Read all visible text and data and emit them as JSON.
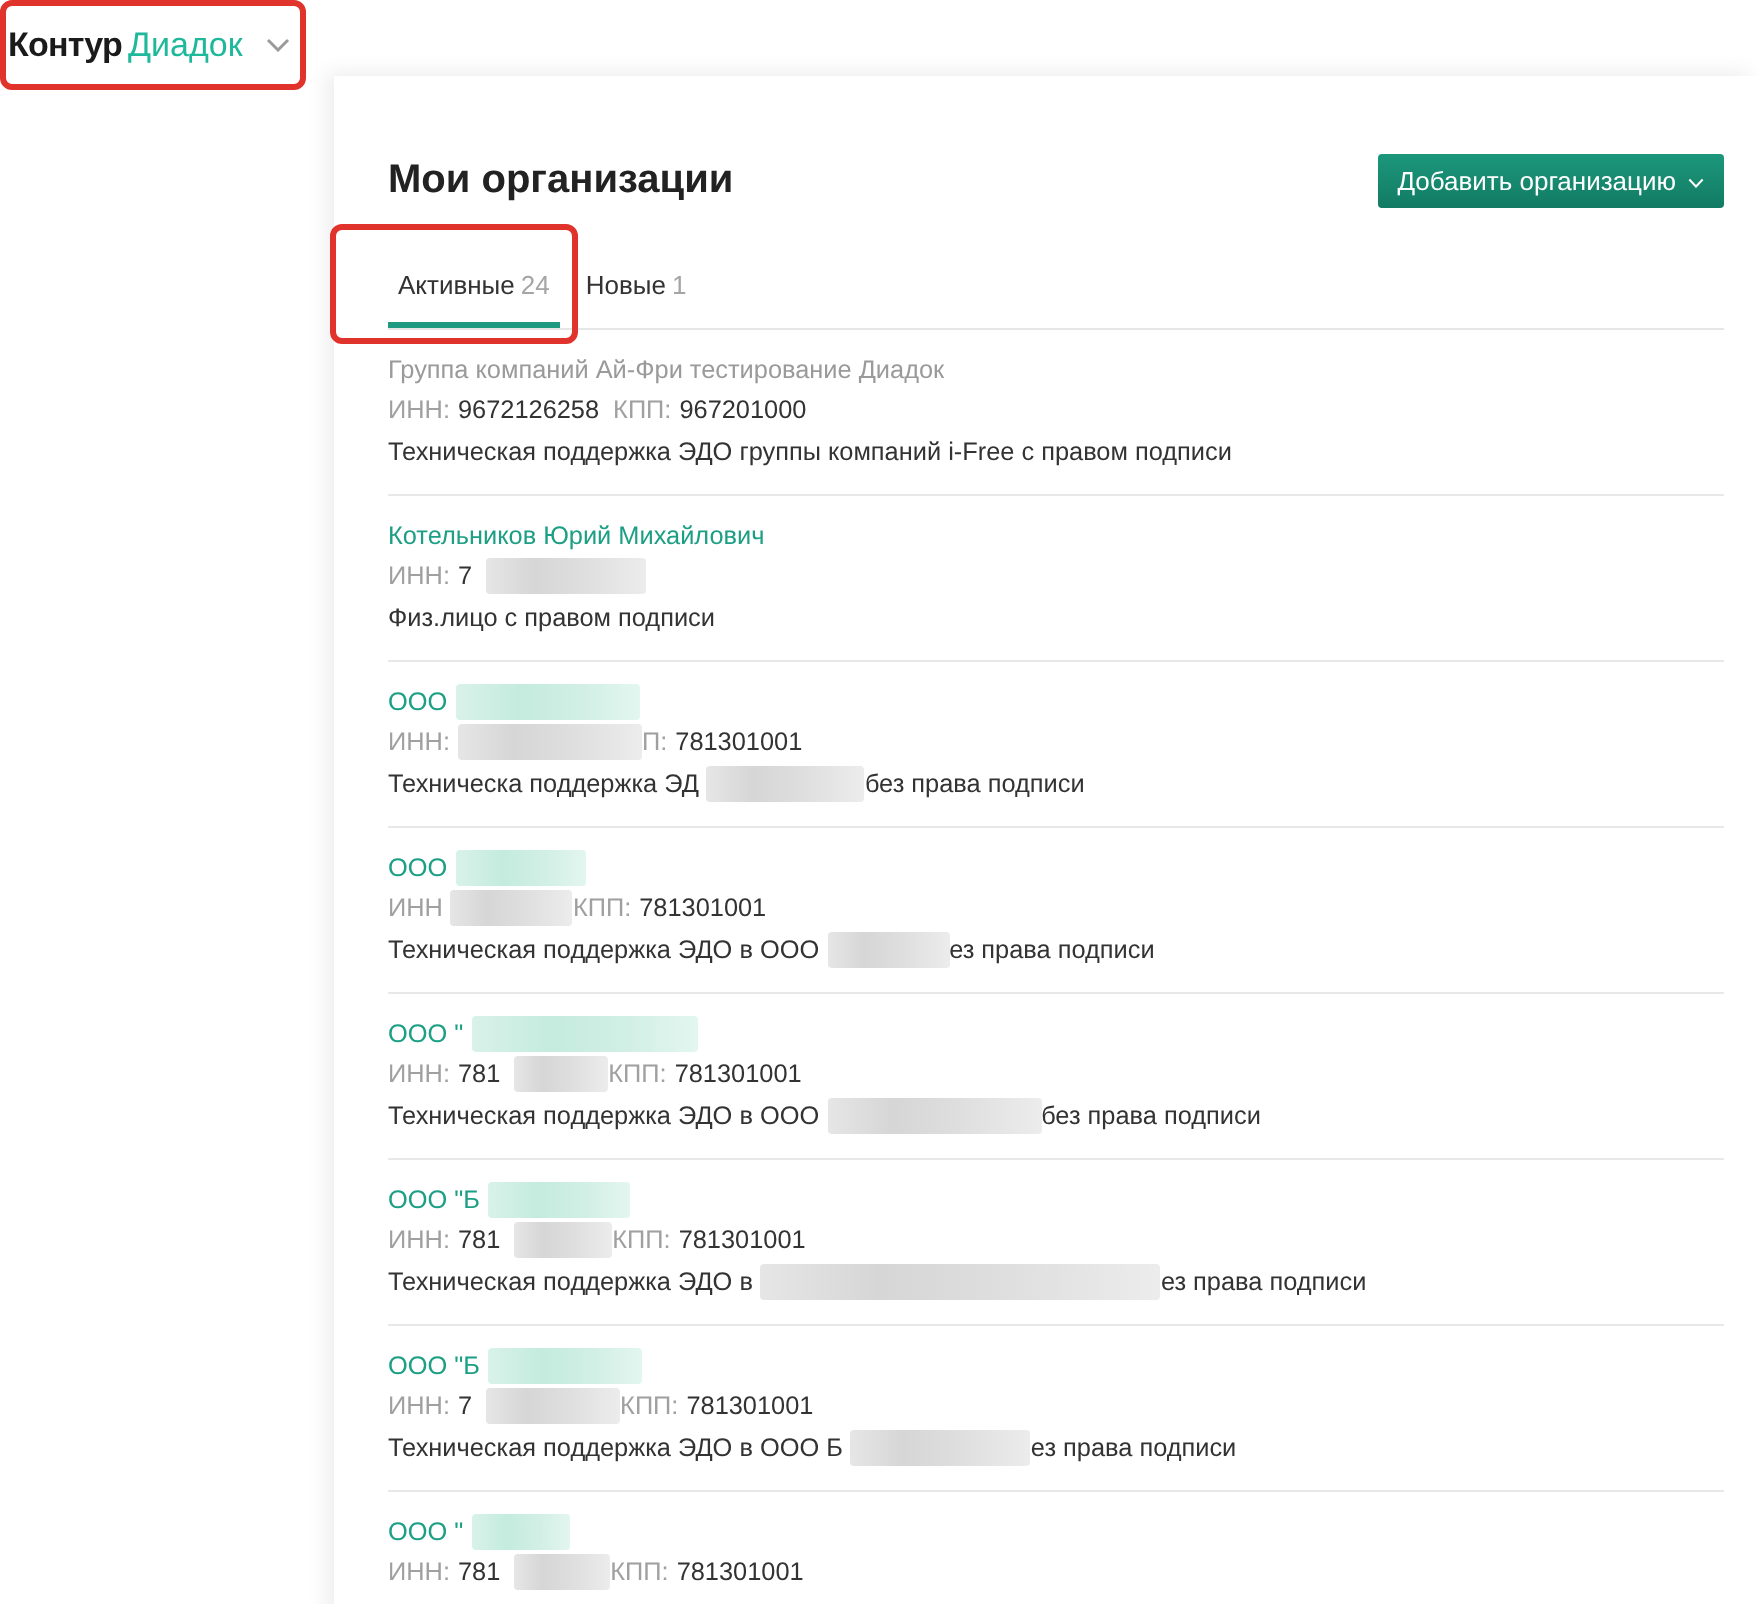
{
  "header": {
    "logo": {
      "brand": "Контур",
      "product": "Диадок",
      "highlighted": true
    }
  },
  "page": {
    "title": "Мои организации",
    "add_button": {
      "label": "Добавить организацию"
    }
  },
  "tabs": [
    {
      "label": "Активные",
      "count": "24",
      "selected": true,
      "highlighted": true
    },
    {
      "label": "Новые",
      "count": "1",
      "selected": false,
      "highlighted": false
    }
  ],
  "organizations": [
    {
      "selected": true,
      "name": [
        {
          "kind": "text",
          "text": "Группа компаний Ай-Фри тестирование Диадок"
        }
      ],
      "details": [
        {
          "kind": "label",
          "text": "ИНН:"
        },
        {
          "kind": "value",
          "text": "9672126258"
        },
        {
          "kind": "label",
          "text": "КПП:"
        },
        {
          "kind": "value",
          "text": "967201000"
        }
      ],
      "description": [
        {
          "kind": "text",
          "text": "Техническая поддержка ЭДО группы компаний i-Free с правом подписи"
        }
      ]
    },
    {
      "selected": false,
      "name": [
        {
          "kind": "text",
          "text": "Котельников Юрий Михайлович"
        }
      ],
      "details": [
        {
          "kind": "label",
          "text": "ИНН:"
        },
        {
          "kind": "value",
          "text": "7"
        },
        {
          "kind": "redacted"
        }
      ],
      "description": [
        {
          "kind": "text",
          "text": "Физ.лицо с правом подписи"
        }
      ]
    },
    {
      "selected": false,
      "name": [
        {
          "kind": "text",
          "text": "ООО"
        },
        {
          "kind": "redacted"
        }
      ],
      "details": [
        {
          "kind": "label",
          "text": "ИНН:"
        },
        {
          "kind": "redacted"
        },
        {
          "kind": "label",
          "text": "П:"
        },
        {
          "kind": "value",
          "text": "781301001"
        }
      ],
      "description": [
        {
          "kind": "text",
          "text": "Техническа поддержка ЭД"
        },
        {
          "kind": "redacted"
        },
        {
          "kind": "text",
          "text": "без права подписи"
        }
      ]
    },
    {
      "selected": false,
      "name": [
        {
          "kind": "text",
          "text": "ООО"
        },
        {
          "kind": "redacted"
        }
      ],
      "details": [
        {
          "kind": "label",
          "text": "ИНН"
        },
        {
          "kind": "redacted"
        },
        {
          "kind": "label",
          "text": "КПП:"
        },
        {
          "kind": "value",
          "text": "781301001"
        }
      ],
      "description": [
        {
          "kind": "text",
          "text": "Техническая поддержка ЭДО в ООО"
        },
        {
          "kind": "redacted"
        },
        {
          "kind": "text",
          "text": "ез права подписи"
        }
      ]
    },
    {
      "selected": false,
      "name": [
        {
          "kind": "text",
          "text": "ООО \""
        },
        {
          "kind": "redacted"
        }
      ],
      "details": [
        {
          "kind": "label",
          "text": "ИНН:"
        },
        {
          "kind": "value",
          "text": "781"
        },
        {
          "kind": "redacted"
        },
        {
          "kind": "label",
          "text": "КПП:"
        },
        {
          "kind": "value",
          "text": "781301001"
        }
      ],
      "description": [
        {
          "kind": "text",
          "text": "Техническая поддержка ЭДО в ООО"
        },
        {
          "kind": "redacted"
        },
        {
          "kind": "text",
          "text": "без права подписи"
        }
      ]
    },
    {
      "selected": false,
      "name": [
        {
          "kind": "text",
          "text": "ООО \"Б"
        },
        {
          "kind": "redacted"
        }
      ],
      "details": [
        {
          "kind": "label",
          "text": "ИНН:"
        },
        {
          "kind": "value",
          "text": "781"
        },
        {
          "kind": "redacted"
        },
        {
          "kind": "label",
          "text": "КПП:"
        },
        {
          "kind": "value",
          "text": "781301001"
        }
      ],
      "description": [
        {
          "kind": "text",
          "text": "Техническая поддержка ЭДО в"
        },
        {
          "kind": "redacted"
        },
        {
          "kind": "text",
          "text": "ез права подписи"
        }
      ]
    },
    {
      "selected": false,
      "name": [
        {
          "kind": "text",
          "text": "ООО \"Б"
        },
        {
          "kind": "redacted"
        }
      ],
      "details": [
        {
          "kind": "label",
          "text": "ИНН:"
        },
        {
          "kind": "value",
          "text": "7"
        },
        {
          "kind": "redacted"
        },
        {
          "kind": "label",
          "text": "КПП:"
        },
        {
          "kind": "value",
          "text": "781301001"
        }
      ],
      "description": [
        {
          "kind": "text",
          "text": "Техническая поддержка ЭДО в ООО Б"
        },
        {
          "kind": "redacted"
        },
        {
          "kind": "text",
          "text": "ез права подписи"
        }
      ]
    },
    {
      "selected": false,
      "name": [
        {
          "kind": "text",
          "text": "ООО \""
        },
        {
          "kind": "redacted"
        }
      ],
      "details": [
        {
          "kind": "label",
          "text": "ИНН:"
        },
        {
          "kind": "value",
          "text": "781"
        },
        {
          "kind": "redacted"
        },
        {
          "kind": "label",
          "text": "КПП:"
        },
        {
          "kind": "value",
          "text": "781301001"
        }
      ]
    }
  ]
}
